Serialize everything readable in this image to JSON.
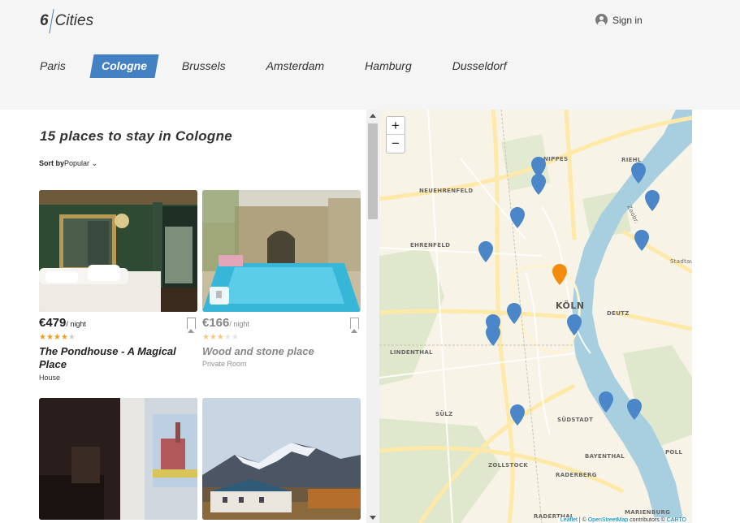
{
  "header": {
    "logo_number": "6",
    "logo_word": "Cities",
    "signin_label": "Sign in"
  },
  "cities": [
    {
      "label": "Paris",
      "active": false
    },
    {
      "label": "Cologne",
      "active": true
    },
    {
      "label": "Brussels",
      "active": false
    },
    {
      "label": "Amsterdam",
      "active": false
    },
    {
      "label": "Hamburg",
      "active": false
    },
    {
      "label": "Dusseldorf",
      "active": false
    }
  ],
  "listing": {
    "title": "15 places to stay in Cologne",
    "sort_label": "Sort by",
    "sort_value": "Popular",
    "sort_arrow": "⌄"
  },
  "offers": [
    {
      "price": "€479",
      "per_night": "/ night",
      "rating_stars": 4,
      "name": "The Pondhouse - A Magical Place",
      "type": "House",
      "bookmarked": false,
      "faded": false
    },
    {
      "price": "€166",
      "per_night": "/ night",
      "rating_stars": 3,
      "name": "Wood and stone place",
      "type": "Private Room",
      "bookmarked": true,
      "faded": true
    },
    {
      "name": "",
      "type": "",
      "faded": false
    },
    {
      "name": "",
      "type": "",
      "faded": false
    }
  ],
  "map": {
    "zoom_in": "+",
    "zoom_out": "−",
    "attribution": {
      "leaflet": "Leaflet",
      "sep1": " | © ",
      "osm": "OpenStreetMap",
      "mid": " contributors © ",
      "carto": "CARTO"
    },
    "labels": {
      "nippes": "NIPPES",
      "riehl": "RIEHL",
      "neuehrenfeld": "NEUEHRENFELD",
      "ehrenfeld": "EHRENFELD",
      "koln": "KÖLN",
      "deutz": "DEUTZ",
      "lindenthal": "LINDENTHAL",
      "sulz": "SÜLZ",
      "sudstadt": "SÜDSTADT",
      "bayenthal": "BAYENTHAL",
      "zollstock": "ZOLLSTOCK",
      "raderberg": "RADERBERG",
      "poll": "POLL",
      "marienburg": "MARIENBURG",
      "raderthal": "RADERTHAL",
      "zoobr": "Zoobr.",
      "stadtau": "Stadtau"
    },
    "colors": {
      "pin_default": "#4a86c8",
      "pin_active": "#f28c0f",
      "water": "#a8cfe0",
      "park": "#d4e5c2",
      "road": "#ffe9a8"
    }
  }
}
